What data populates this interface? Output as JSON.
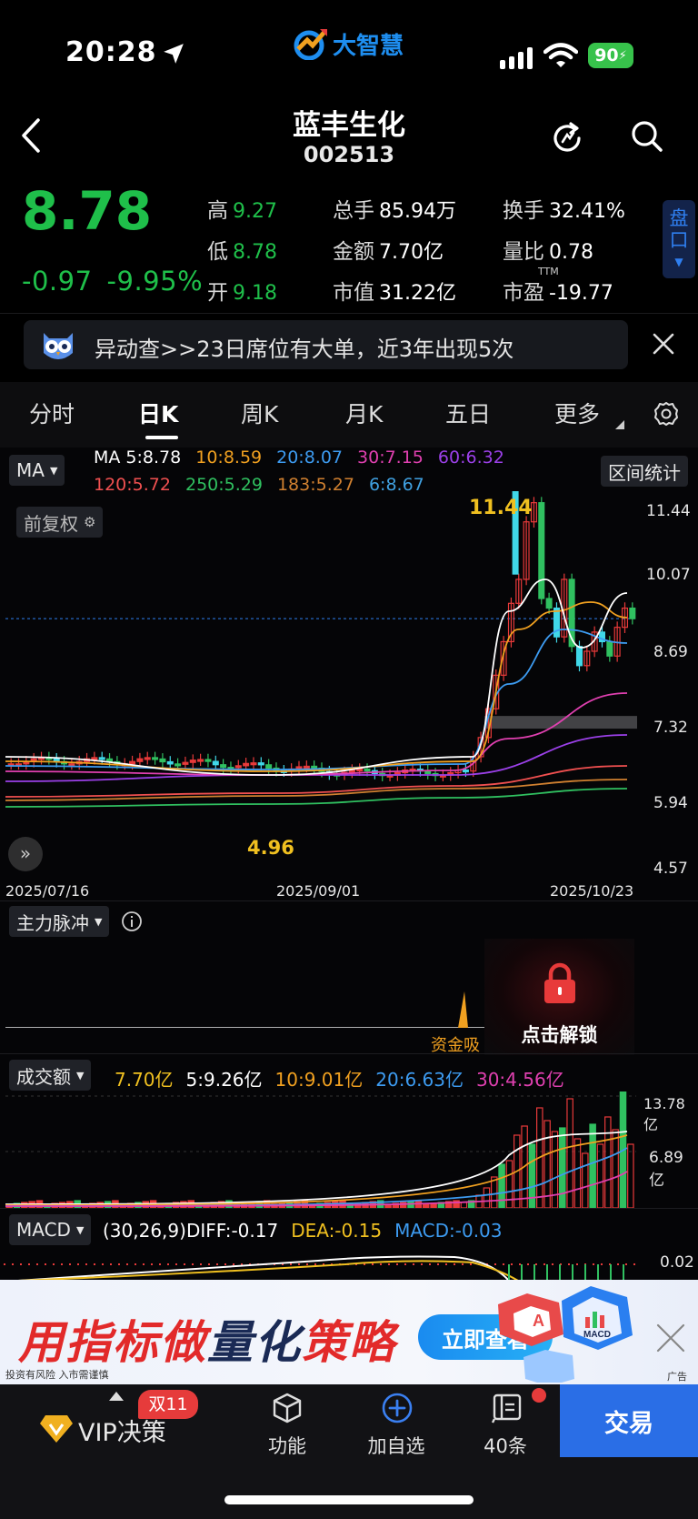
{
  "status_bar": {
    "time": "20:28",
    "battery": "90"
  },
  "brand": {
    "name": "大智慧"
  },
  "header": {
    "stock_name": "蓝丰生化",
    "stock_code": "002513"
  },
  "quote": {
    "price": "8.78",
    "change": "-0.97",
    "change_pct": "-9.95%",
    "high_label": "高",
    "high": "9.27",
    "low_label": "低",
    "low": "8.78",
    "open_label": "开",
    "open": "9.18",
    "volume_label": "总手",
    "volume": "85.94万",
    "amount_label": "金额",
    "amount": "7.70亿",
    "mktcap_label": "市值",
    "mktcap": "31.22亿",
    "turnover_label": "换手",
    "turnover": "32.41%",
    "volratio_label": "量比",
    "volratio": "0.78",
    "pe_label": "市盈",
    "pe_ttm_tag": "TTM",
    "pe": "-19.77",
    "pankou_label": "盘口"
  },
  "alert": {
    "text": "异动查>>23日席位有大单，近3年出现5次"
  },
  "tabs": [
    {
      "label": "分时"
    },
    {
      "label": "日K"
    },
    {
      "label": "周K"
    },
    {
      "label": "月K"
    },
    {
      "label": "五日"
    },
    {
      "label": "更多"
    }
  ],
  "kline": {
    "indicator": "MA",
    "ma": [
      {
        "label": "MA 5:8.78",
        "color": "#ffffff"
      },
      {
        "label": "10:8.59",
        "color": "#f0a020"
      },
      {
        "label": "20:8.07",
        "color": "#3d9bf0"
      },
      {
        "label": "30:7.15",
        "color": "#e040b0"
      },
      {
        "label": "60:6.32",
        "color": "#9b40e8"
      },
      {
        "label": "120:5.72",
        "color": "#f05050"
      },
      {
        "label": "250:5.29",
        "color": "#30c060"
      },
      {
        "label": "183:5.27",
        "color": "#d08030"
      },
      {
        "label": "6:8.67",
        "color": "#40a0e0"
      }
    ],
    "range_stats": "区间统计",
    "adjust": "前复权",
    "high_mark": "11.44",
    "low_mark": "4.96",
    "y_ticks": [
      "11.44",
      "10.07",
      "8.69",
      "7.32",
      "5.94",
      "4.57"
    ],
    "dates": [
      "2025/07/16",
      "2025/09/01",
      "2025/10/23"
    ]
  },
  "main_force": {
    "label": "主力脉冲",
    "fund_label": "资金吸",
    "unlock": "点击解锁"
  },
  "turnover_panel": {
    "label": "成交额",
    "values": [
      {
        "text": "7.70亿",
        "color": "#f0c020"
      },
      {
        "text": "5:9.26亿",
        "color": "#ffffff"
      },
      {
        "text": "10:9.01亿",
        "color": "#f0a020"
      },
      {
        "text": "20:6.63亿",
        "color": "#3d9bf0"
      },
      {
        "text": "30:4.56亿",
        "color": "#e040b0"
      }
    ],
    "y_ticks": [
      "13.78亿",
      "6.89亿"
    ]
  },
  "macd": {
    "label": "MACD",
    "params": "(30,26,9)",
    "diff": "DIFF:-0.17",
    "dea": "DEA:-0.15",
    "macd": "MACD:-0.03",
    "y_tick": "0.02"
  },
  "banner": {
    "title_red_1": "用指标做",
    "title_dark": "量化",
    "title_red_2": "策略",
    "cta": "立即查看",
    "note": "投资有风险 入市需谨慎",
    "ad_tag": "广告",
    "badge_a": "A",
    "badge_macd": "MACD"
  },
  "bottom_nav": {
    "vip": "VIP决策",
    "vip_badge": "双11",
    "func": "功能",
    "add": "加自选",
    "msgs": "40条",
    "trade": "交易"
  }
}
